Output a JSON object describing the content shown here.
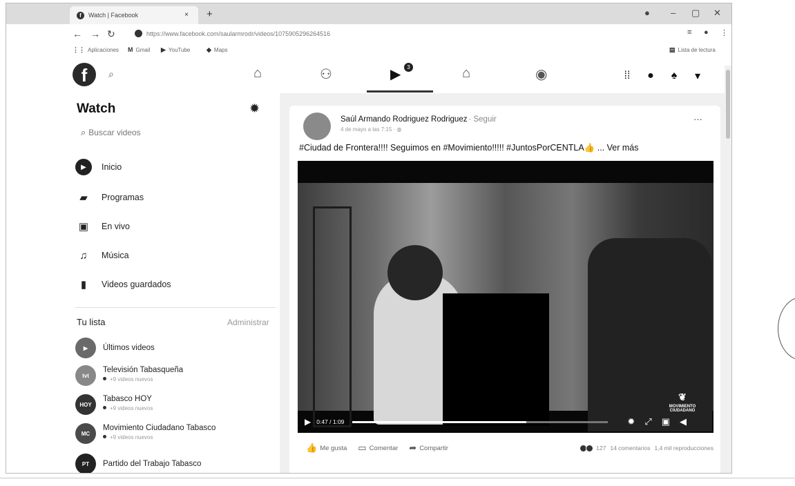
{
  "browser": {
    "tab_title": "Watch | Facebook",
    "tab_close": "×",
    "new_tab": "+",
    "url": "https://www.facebook.com/saularmrodr/videos/1075905296264516",
    "bookmarks": [
      {
        "label": "Aplicaciones",
        "icon": "apps-grid-icon"
      },
      {
        "label": "Gmail",
        "icon": "gmail-icon"
      },
      {
        "label": "YouTube",
        "icon": "youtube-icon"
      },
      {
        "label": "Maps",
        "icon": "maps-icon"
      }
    ],
    "reading_list": "Lista de lectura"
  },
  "fb_nav": {
    "search_placeholder_icon": "search-icon",
    "watch_badge": "3",
    "tabs": [
      "home",
      "friends",
      "watch",
      "marketplace",
      "groups"
    ]
  },
  "sidebar": {
    "title": "Watch",
    "search_placeholder": "Buscar videos",
    "menu": [
      {
        "label": "Inicio",
        "icon": "play-circle-icon"
      },
      {
        "label": "Programas",
        "icon": "shows-icon"
      },
      {
        "label": "En vivo",
        "icon": "live-camera-icon"
      },
      {
        "label": "Música",
        "icon": "music-note-icon"
      },
      {
        "label": "Videos guardados",
        "icon": "bookmark-icon"
      }
    ],
    "list_title": "Tu lista",
    "manage": "Administrar",
    "subscriptions": [
      {
        "name": "Últimos videos",
        "avatar": "",
        "new": ""
      },
      {
        "name": "Televisión Tabasqueña",
        "avatar": "tvt",
        "new": "+9 videos nuevos"
      },
      {
        "name": "Tabasco HOY",
        "avatar": "HOY",
        "new": "+9 videos nuevos"
      },
      {
        "name": "Movimiento Ciudadano Tabasco",
        "avatar": "MC",
        "new": "+9 videos nuevos"
      },
      {
        "name": "Partido del Trabajo Tabasco",
        "avatar": "PT",
        "new": ""
      }
    ]
  },
  "post": {
    "author": "Saúl Armando Rodriguez Rodriguez",
    "follow": "· Seguir",
    "date": "4 de mayo a las 7:15 · ",
    "text": "#Ciudad de Frontera!!!! Seguimos en #Movimiento!!!!! #JuntosPorCENTLA",
    "emoji": "👍",
    "see_more": " ... Ver más",
    "more_options": "···",
    "video": {
      "time": "0:47 / 1:09",
      "progress_fraction": 0.68,
      "brand": "MOVIMIENTO CIUDADANO"
    },
    "actions": {
      "like": "Me gusta",
      "comment": "Comentar",
      "share": "Compartir"
    },
    "stats": {
      "reactions": "127",
      "comments": "14 comentarios",
      "views": "1,4 mil reproducciones"
    }
  }
}
